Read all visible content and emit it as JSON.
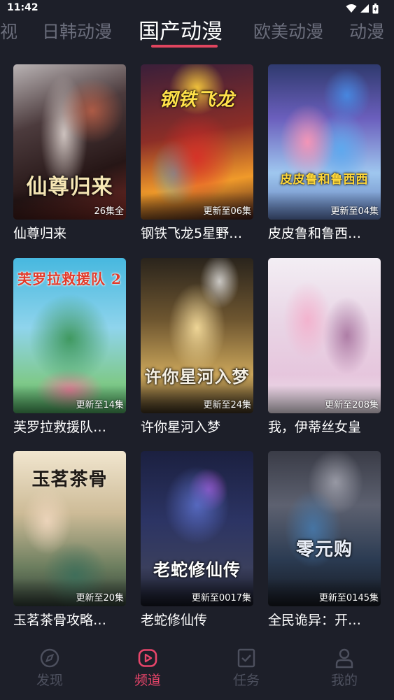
{
  "status_bar": {
    "time": "11:42"
  },
  "category_tabs": [
    {
      "label": "视",
      "active": false
    },
    {
      "label": "日韩动漫",
      "active": false
    },
    {
      "label": "国产动漫",
      "active": true
    },
    {
      "label": "欧美动漫",
      "active": false
    },
    {
      "label": "动漫",
      "active": false
    }
  ],
  "accent_color": "#e0455f",
  "items": [
    {
      "title": "仙尊归来",
      "badge": "26集全",
      "poster_text": "仙尊归来"
    },
    {
      "title": "钢铁飞龙5星野…",
      "badge": "更新至06集",
      "poster_text": "钢铁飞龙"
    },
    {
      "title": "皮皮鲁和鲁西…",
      "badge": "更新至04集",
      "poster_text": "皮皮鲁和鲁西西"
    },
    {
      "title": "芙罗拉救援队…",
      "badge": "更新至14集",
      "poster_text": "芙罗拉救援队 2"
    },
    {
      "title": "许你星河入梦",
      "badge": "更新至24集",
      "poster_text": "许你星河入梦"
    },
    {
      "title": "我，伊蒂丝女皇",
      "badge": "更新至208集",
      "poster_text": ""
    },
    {
      "title": "玉茗茶骨攻略…",
      "badge": "更新至20集",
      "poster_text": "玉茗茶骨"
    },
    {
      "title": "老蛇修仙传",
      "badge": "更新至0017集",
      "poster_text": "老蛇修仙传"
    },
    {
      "title": "全民诡异：开…",
      "badge": "更新至0145集",
      "poster_text": "零元购"
    }
  ],
  "bottom_nav": [
    {
      "label": "发现",
      "icon": "compass-icon",
      "active": false
    },
    {
      "label": "频道",
      "icon": "play-icon",
      "active": true
    },
    {
      "label": "任务",
      "icon": "task-icon",
      "active": false
    },
    {
      "label": "我的",
      "icon": "user-icon",
      "active": false
    }
  ]
}
